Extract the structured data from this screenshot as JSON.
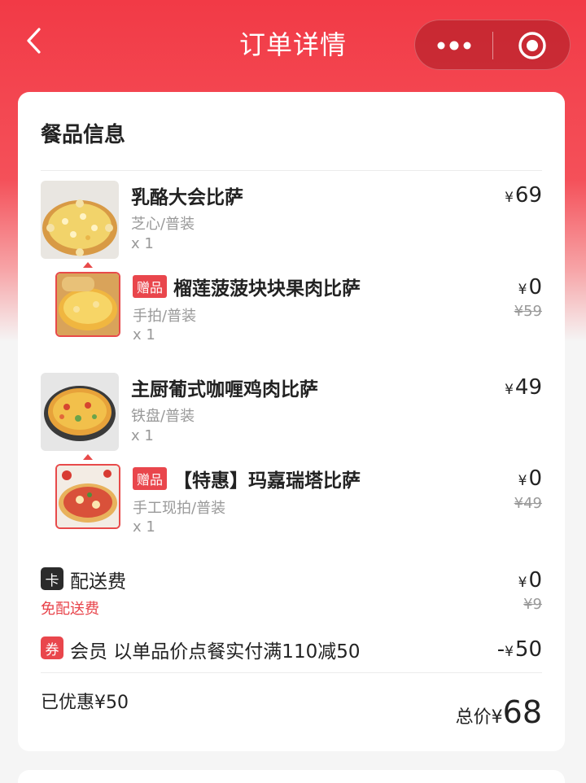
{
  "header": {
    "title": "订单详情",
    "back_icon": "chevron-left-icon",
    "more_icon": "more-dots-icon",
    "close_icon": "target-close-icon"
  },
  "section": {
    "title": "餐品信息"
  },
  "items": [
    {
      "name": "乳酪大会比萨",
      "spec": "芝心/普装",
      "qty": "x 1",
      "currency": "¥",
      "price": "69",
      "gift": {
        "tag": "赠品",
        "name": "榴莲菠菠块块果肉比萨",
        "spec": "手拍/普装",
        "qty": "x 1",
        "currency": "¥",
        "price": "0",
        "original": "¥59"
      }
    },
    {
      "name": "主厨葡式咖喱鸡肉比萨",
      "spec": "铁盘/普装",
      "qty": "x 1",
      "currency": "¥",
      "price": "49",
      "gift": {
        "tag": "赠品",
        "name": "【特惠】玛嘉瑞塔比萨",
        "spec": "手工现拍/普装",
        "qty": "x 1",
        "currency": "¥",
        "price": "0",
        "original": "¥49"
      }
    }
  ],
  "delivery": {
    "icon_text": "卡",
    "label": "配送费",
    "note": "免配送费",
    "currency": "¥",
    "price": "0",
    "original": "¥9"
  },
  "coupon": {
    "icon_text": "券",
    "label": "会员 以单品价点餐实付满110减50",
    "amount_prefix": "-",
    "currency": "¥",
    "amount": "50"
  },
  "summary": {
    "saved": "已优惠¥50",
    "total_label": "总价",
    "currency": "¥",
    "total": "68"
  },
  "colors": {
    "brand_red": "#f23a46",
    "tag_red": "#e9464c",
    "dark_icon": "#2b2b2b"
  }
}
